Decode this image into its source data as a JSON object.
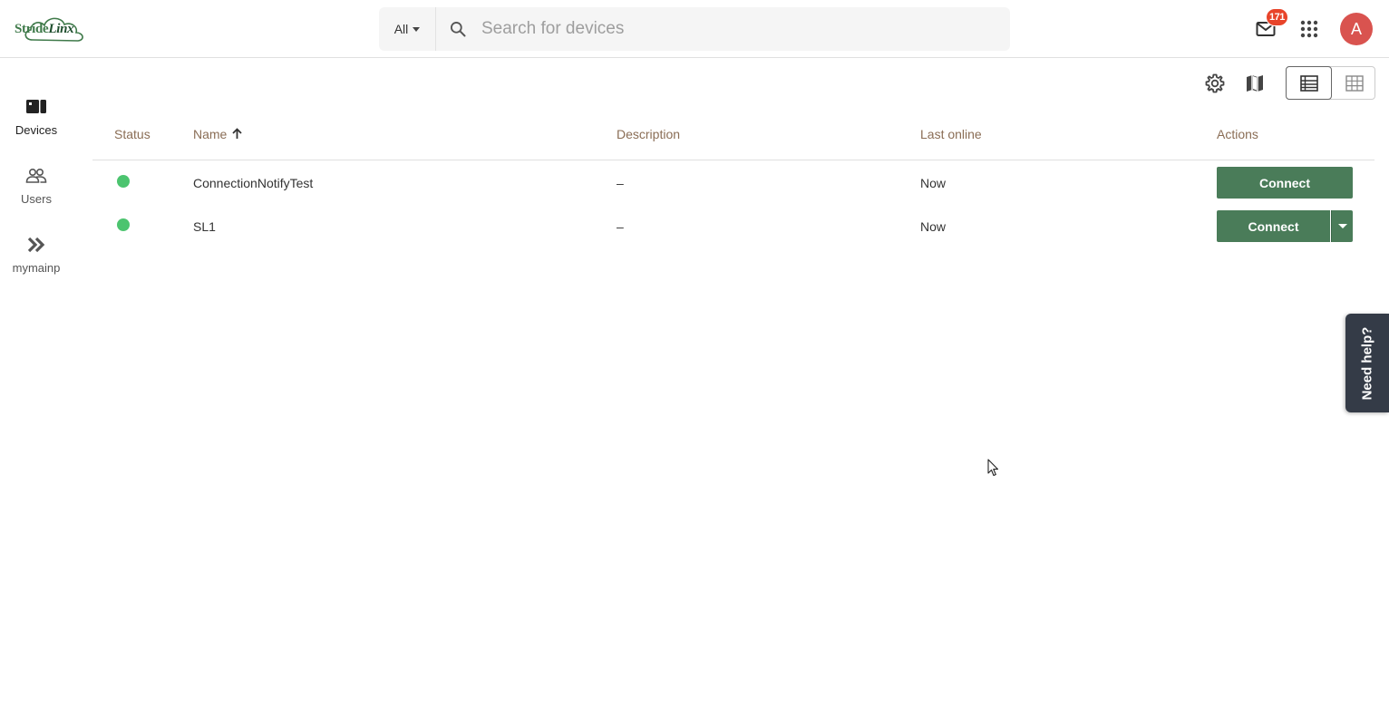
{
  "brand": {
    "logo_text_a": "Stri",
    "logo_text_b": "de",
    "logo_text_c": "Linx"
  },
  "search": {
    "scope_label": "All",
    "placeholder": "Search for devices",
    "value": ""
  },
  "header": {
    "notifications_count": "171",
    "avatar_initial": "A"
  },
  "sidebar": {
    "items": [
      {
        "label": "Devices",
        "icon": "devices-icon"
      },
      {
        "label": "Users",
        "icon": "users-icon"
      },
      {
        "label": "mymainp",
        "icon": "double-chevron-icon"
      }
    ]
  },
  "table": {
    "columns": {
      "status": "Status",
      "name": "Name",
      "description": "Description",
      "last_online": "Last online",
      "actions": "Actions"
    },
    "rows": [
      {
        "name": "ConnectionNotifyTest",
        "description": "–",
        "last_online": "Now",
        "action": "Connect"
      },
      {
        "name": "SL1",
        "description": "–",
        "last_online": "Now",
        "action": "Connect"
      }
    ]
  },
  "help": {
    "label": "Need help?"
  },
  "colors": {
    "primary_button": "#4a7c59",
    "online": "#4cc46f",
    "badge": "#e8442a",
    "avatar": "#d9534f",
    "help_tab": "#343b47"
  }
}
